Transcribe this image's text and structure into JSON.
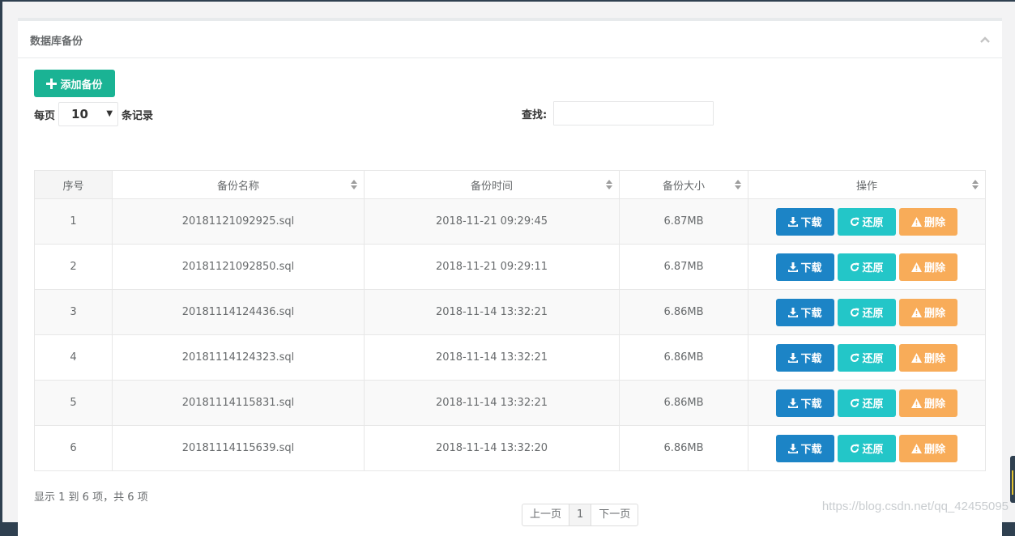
{
  "panel": {
    "title": "数据库备份"
  },
  "toolbar": {
    "add_label": "添加备份"
  },
  "length_menu": {
    "prefix": "每页",
    "value": "10",
    "suffix": "条记录"
  },
  "search": {
    "label": "查找:",
    "value": ""
  },
  "table": {
    "headers": [
      "序号",
      "备份名称",
      "备份时间",
      "备份大小",
      "操作"
    ],
    "rows": [
      {
        "index": "1",
        "name": "20181121092925.sql",
        "time": "2018-11-21 09:29:45",
        "size": "6.87MB"
      },
      {
        "index": "2",
        "name": "20181121092850.sql",
        "time": "2018-11-21 09:29:11",
        "size": "6.87MB"
      },
      {
        "index": "3",
        "name": "20181114124436.sql",
        "time": "2018-11-14 13:32:21",
        "size": "6.86MB"
      },
      {
        "index": "4",
        "name": "20181114124323.sql",
        "time": "2018-11-14 13:32:21",
        "size": "6.86MB"
      },
      {
        "index": "5",
        "name": "20181114115831.sql",
        "time": "2018-11-14 13:32:21",
        "size": "6.86MB"
      },
      {
        "index": "6",
        "name": "20181114115639.sql",
        "time": "2018-11-14 13:32:20",
        "size": "6.86MB"
      }
    ],
    "actions": {
      "download": "下载",
      "restore": "还原",
      "delete": "删除"
    }
  },
  "info": "显示 1 到 6 项，共 6 项",
  "pagination": {
    "prev": "上一页",
    "current": "1",
    "next": "下一页"
  },
  "watermark": "https://blog.csdn.net/qq_42455095",
  "colors": {
    "primary": "#1ab394",
    "download": "#1c84c6",
    "restore": "#23c6c8",
    "delete": "#f8ac59"
  }
}
